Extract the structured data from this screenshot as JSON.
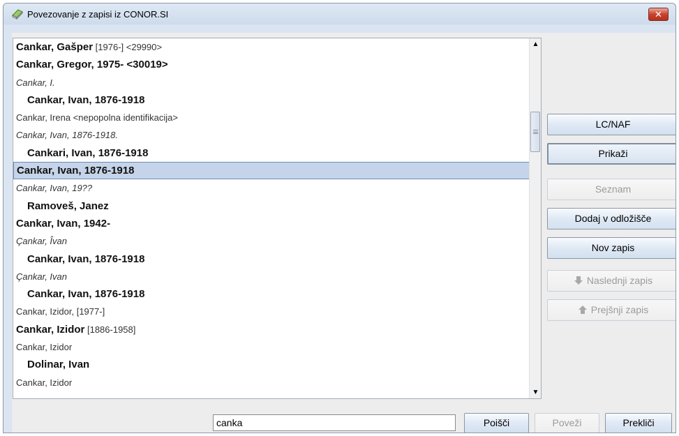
{
  "window": {
    "title": "Povezovanje z zapisi iz CONOR.SI",
    "close_label": "✕"
  },
  "list": {
    "rows": [
      {
        "bold": "Cankar, Gašper",
        "normal": " [1976-] <29990>"
      },
      {
        "bold": "Cankar, Gregor, 1975- <30019>",
        "normal": ""
      },
      {
        "italic": "Cankar, I."
      },
      {
        "indent": "Cankar, Ivan, 1876-1918"
      },
      {
        "normal_only": "Cankar, Irena <nepopolna identifikacija>"
      },
      {
        "italic": "Cankar, Ivan, 1876-1918."
      },
      {
        "indent": "Cankari, Ivan, 1876-1918"
      },
      {
        "bold": "Cankar, Ivan, 1876-1918",
        "normal": "",
        "selected": true
      },
      {
        "italic": "Cankar, Ivan, 19??"
      },
      {
        "indent": "Ramoveš, Janez"
      },
      {
        "bold": "Cankar, Ivan, 1942-",
        "normal": ""
      },
      {
        "italic": "Çankar, Îvan"
      },
      {
        "indent": "Cankar, Ivan, 1876-1918"
      },
      {
        "italic": "Çankar, Ivan"
      },
      {
        "indent": "Cankar, Ivan, 1876-1918"
      },
      {
        "normal_only": "Cankar, Izidor, [1977-]"
      },
      {
        "bold": "Cankar, Izidor",
        "normal": " [1886-1958]"
      },
      {
        "normal_only": "Cankar, Izidor"
      },
      {
        "indent": "Dolinar, Ivan"
      },
      {
        "normal_only": "Cankar, Izidor"
      }
    ]
  },
  "side_buttons": {
    "lcnaf": "LC/NAF",
    "prikazi": "Prikaži",
    "seznam": "Seznam",
    "dodaj": "Dodaj v odložišče",
    "nov_zapis": "Nov zapis",
    "naslednji": "Naslednji zapis",
    "prejsnji": "Prejšnji zapis"
  },
  "bottom": {
    "search_value": "canka",
    "poisci": "Poišči",
    "povezi": "Poveži",
    "preklici": "Prekliči"
  }
}
